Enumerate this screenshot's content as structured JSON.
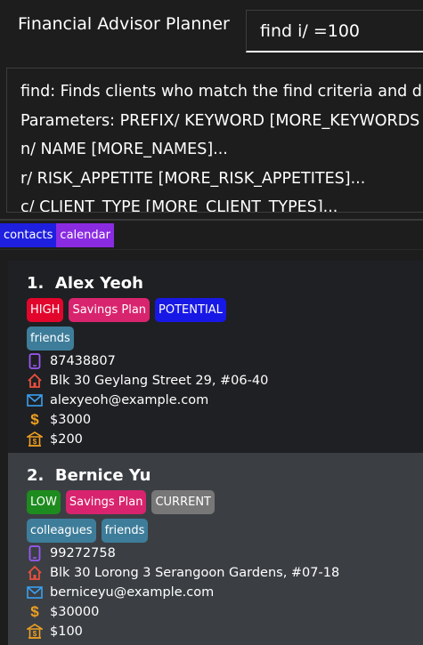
{
  "header": {
    "title": "Financial Advisor Planner",
    "command_value": "find i/ =100"
  },
  "result": {
    "lines": [
      "find: Finds clients who match the find criteria and d",
      "Parameters: PREFIX/ KEYWORD [MORE_KEYWORDS",
      "n/ NAME [MORE_NAMES]...",
      "r/ RISK_APPETITE [MORE_RISK_APPETITES]...",
      "c/ CLIENT_TYPE [MORE_CLIENT_TYPES]..."
    ]
  },
  "tabs": [
    {
      "label": "contacts",
      "color": "#1f1fe0"
    },
    {
      "label": "calendar",
      "color": "#8a2be2"
    }
  ],
  "contacts": [
    {
      "index": "1.",
      "name": "Alex Yeoh",
      "risk": "HIGH",
      "plan": "Savings Plan",
      "client_type": "POTENTIAL",
      "tags": [
        "friends"
      ],
      "phone": "87438807",
      "address": "Blk 30 Geylang Street 29, #06-40",
      "email": "alexyeoh@example.com",
      "income": "$3000",
      "investment": "$200"
    },
    {
      "index": "2.",
      "name": "Bernice Yu",
      "risk": "LOW",
      "plan": "Savings Plan",
      "client_type": "CURRENT",
      "tags": [
        "colleagues",
        "friends"
      ],
      "phone": "99272758",
      "address": "Blk 30 Lorong 3 Serangoon Gardens, #07-18",
      "email": "berniceyu@example.com",
      "income": "$30000",
      "investment": "$100"
    }
  ],
  "icons": {
    "phone": "phone-icon",
    "address": "house-icon",
    "email": "mail-icon",
    "income": "dollar-icon",
    "investment": "bank-icon"
  },
  "colors": {
    "background": "#1d1d1d",
    "card_odd": "#1f2023",
    "card_even": "#3b3f44",
    "tag_high": "#e2062c",
    "tag_low": "#1e8b1e",
    "tag_plan": "#d8246e",
    "tag_potential": "#1818e6",
    "tag_current": "#777777",
    "tag_friends": "#3e7d9a",
    "icon_phone": "#9b59f5",
    "icon_house": "#e8503c",
    "icon_mail": "#3aa0f0",
    "icon_dollar": "#f0a020",
    "icon_bank": "#f0a020"
  }
}
